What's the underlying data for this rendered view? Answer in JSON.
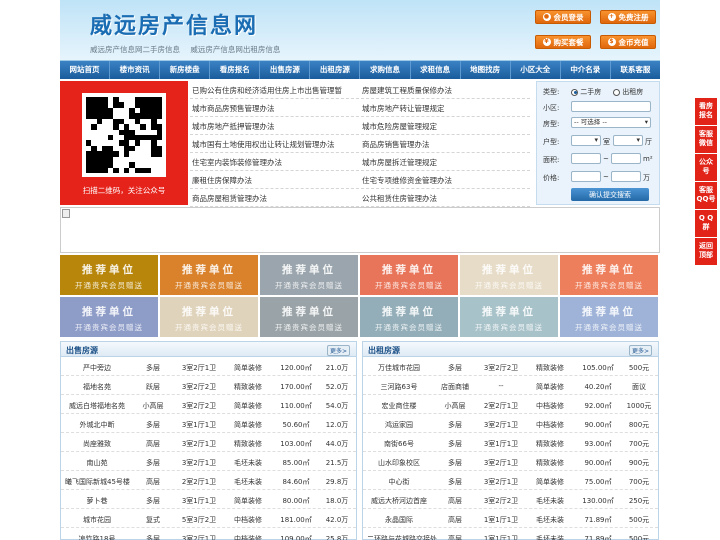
{
  "site": {
    "logo": "威远房产信息网",
    "taglines": [
      "威远房产信息网二手房信息",
      "威远房产信息网出租房信息"
    ]
  },
  "header_buttons": [
    {
      "label": "会员登录",
      "icon": "user-icon"
    },
    {
      "label": "免费注册",
      "icon": "register-icon"
    },
    {
      "label": "购买套餐",
      "icon": "cart-icon"
    },
    {
      "label": "金币充值",
      "icon": "coin-icon"
    }
  ],
  "nav": [
    "网站首页",
    "楼市资讯",
    "新房楼盘",
    "看房报名",
    "出售房源",
    "出租房源",
    "求购信息",
    "求租信息",
    "地图找房",
    "小区大全",
    "中介名录",
    "联系客服"
  ],
  "qr": {
    "caption": "扫描二维码，关注公众号"
  },
  "news": [
    [
      "已购公有住房和经济适用住房上市出售管理暂",
      "房屋建筑工程质量保修办法"
    ],
    [
      "城市商品房预售管理办法",
      "城市房地产转让管理规定"
    ],
    [
      "城市房地产抵押管理办法",
      "城市危险房屋管理规定"
    ],
    [
      "城市国有土地使用权出让转让规划管理办法",
      "商品房销售管理办法"
    ],
    [
      "住宅室内装饰装修管理办法",
      "城市房屋拆迁管理规定"
    ],
    [
      "廉租住房保障办法",
      "住宅专项维修资金管理办法"
    ],
    [
      "商品房屋租赁管理办法",
      "公共租赁住房管理办法"
    ]
  ],
  "search": {
    "type_label": "类型:",
    "type_options": [
      "二手房",
      "出租房"
    ],
    "community_label": "小区:",
    "house_type_label": "房型:",
    "house_type_value": "-- 可选择 --",
    "layout_label": "户型:",
    "room_unit": "室",
    "hall_unit": "厅",
    "area_label": "面积:",
    "area_unit": "m²",
    "price_label": "价格:",
    "price_unit": "万",
    "submit": "确认提交搜索"
  },
  "ads": {
    "title": "推荐单位",
    "subtitle": "开通贵宾会员赠送",
    "colors": [
      "#b8860b",
      "#d9822b",
      "#9aa5ad",
      "#e8755a",
      "#e7dcc7",
      "#ee7f5c",
      "#8e9cc8",
      "#e0d3bb",
      "#9aa3a7",
      "#93aeb8",
      "#a8c2c9",
      "#9fb3d8"
    ]
  },
  "sale": {
    "title": "出售房源",
    "more": "更多>",
    "rows": [
      [
        "严中旁边",
        "多层",
        "3室2厅1卫",
        "简单装修",
        "120.00㎡",
        "21.0万"
      ],
      [
        "福地名苑",
        "跃层",
        "3室2厅2卫",
        "精致装修",
        "170.00㎡",
        "52.0万"
      ],
      [
        "威远白塔福地名苑",
        "小高层",
        "3室2厅2卫",
        "简单装修",
        "110.00㎡",
        "54.0万"
      ],
      [
        "外城北中断",
        "多层",
        "3室1厅1卫",
        "简单装修",
        "50.60㎡",
        "12.0万"
      ],
      [
        "尚座雅致",
        "高层",
        "3室2厅1卫",
        "精致装修",
        "103.00㎡",
        "44.0万"
      ],
      [
        "南山苑",
        "多层",
        "3室2厅1卫",
        "毛坯未装",
        "85.00㎡",
        "21.5万"
      ],
      [
        "曦飞国际新城45号楼",
        "高层",
        "2室2厅1卫",
        "毛坯未装",
        "84.60㎡",
        "29.8万"
      ],
      [
        "萝卜巷",
        "多层",
        "3室1厅1卫",
        "简单装修",
        "80.00㎡",
        "18.0万"
      ],
      [
        "城市花园",
        "复式",
        "5室3厅2卫",
        "中档装修",
        "181.00㎡",
        "42.0万"
      ],
      [
        "凉竹路18号",
        "多层",
        "3室2厅1卫",
        "中档装修",
        "109.00㎡",
        "25.8万"
      ]
    ]
  },
  "rent": {
    "title": "出租房源",
    "more": "更多>",
    "rows": [
      [
        "万佳城市花园",
        "多层",
        "3室2厅2卫",
        "精致装修",
        "105.00㎡",
        "500元"
      ],
      [
        "三河路63号",
        "店面商铺",
        "--",
        "简单装修",
        "40.20㎡",
        "面议"
      ],
      [
        "宏业商住楼",
        "小高层",
        "2室2厅1卫",
        "中档装修",
        "92.00㎡",
        "1000元"
      ],
      [
        "鸿运家园",
        "多层",
        "3室2厅1卫",
        "中档装修",
        "90.00㎡",
        "800元"
      ],
      [
        "南街66号",
        "多层",
        "3室1厅1卫",
        "精致装修",
        "93.00㎡",
        "700元"
      ],
      [
        "山水印象校区",
        "多层",
        "3室2厅1卫",
        "精致装修",
        "90.00㎡",
        "900元"
      ],
      [
        "中心街",
        "多层",
        "3室2厅1卫",
        "简单装修",
        "75.00㎡",
        "700元"
      ],
      [
        "威远大桥河边首座",
        "高层",
        "3室2厅2卫",
        "毛坯未装",
        "130.00㎡",
        "250元"
      ],
      [
        "永晶国际",
        "高层",
        "1室1厅1卫",
        "毛坯未装",
        "71.89㎡",
        "500元"
      ],
      [
        "二环路与花城路交接处",
        "高层",
        "1室1厅1卫",
        "毛坯未装",
        "71.89㎡",
        "500元"
      ]
    ]
  },
  "side_buttons": [
    [
      "看房",
      "报名"
    ],
    [
      "客服",
      "微信"
    ],
    [
      "公众",
      "号"
    ],
    [
      "客服",
      "QQ号"
    ],
    [
      "Q Q",
      "群"
    ],
    [
      "返回",
      "顶部"
    ]
  ]
}
